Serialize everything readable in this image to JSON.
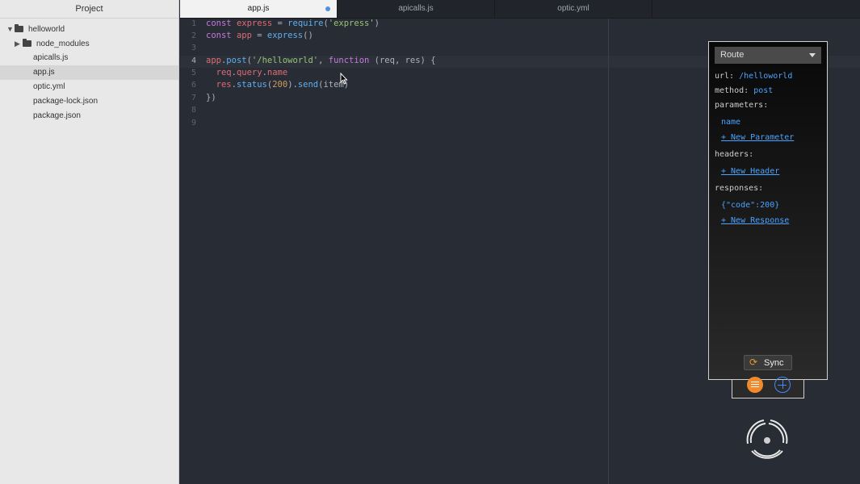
{
  "sidebar": {
    "header": "Project",
    "root": "helloworld",
    "folders": [
      "node_modules"
    ],
    "files": [
      "apicalls.js",
      "app.js",
      "optic.yml",
      "package-lock.json",
      "package.json"
    ]
  },
  "tabs": [
    {
      "label": "app.js",
      "modified": true
    },
    {
      "label": "apicalls.js"
    },
    {
      "label": "optic.yml"
    }
  ],
  "editor": {
    "line_numbers": [
      "1",
      "2",
      "3",
      "4",
      "5",
      "6",
      "7",
      "8",
      "9"
    ],
    "cursor_line": 4
  },
  "panel": {
    "route_select": "Route",
    "url_label": "url:",
    "url_value": "/helloworld",
    "method_label": "method:",
    "method_value": "post",
    "parameters_label": "parameters:",
    "parameters": [
      "name"
    ],
    "new_parameter": "+ New Parameter",
    "headers_label": "headers:",
    "new_header": "+ New Header",
    "responses_label": "responses:",
    "responses": [
      "{\"code\":200}"
    ],
    "new_response": "+ New Response",
    "sync_label": "Sync"
  },
  "colors": {
    "accent_blue": "#4aa3ff",
    "sync_orange": "#f08a2c",
    "editor_bg": "#282c34"
  }
}
